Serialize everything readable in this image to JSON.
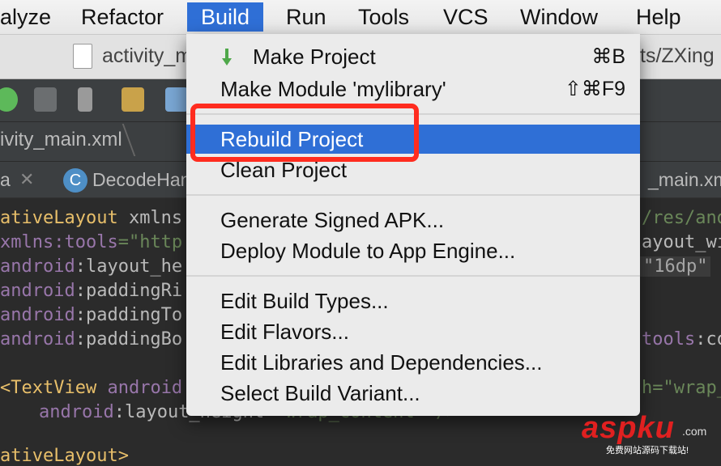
{
  "menubar": {
    "items": [
      "alyze",
      "Refactor",
      "Build",
      "Run",
      "Tools",
      "VCS",
      "Window",
      "Help"
    ],
    "active": "Build"
  },
  "titlebar": {
    "filename": "activity_m",
    "path_tail": "ts/ZXing"
  },
  "breadcrumb": {
    "file": "ivity_main.xml"
  },
  "tabs": [
    {
      "label": "a"
    },
    {
      "label": "DecodeHan",
      "icon": "C"
    },
    {
      "label": "_main.xm"
    }
  ],
  "editor": {
    "lines": [
      {
        "tag": "ativeLayout",
        "text": " xmlns"
      },
      {
        "ns": "xmlns:tools",
        "eq": "=\"http"
      },
      {
        "ns": "android",
        "attr": ":layout_he"
      },
      {
        "ns": "android",
        "attr": ":paddingRi"
      },
      {
        "ns": "android",
        "attr": ":paddingTo"
      },
      {
        "ns": "android",
        "attr": ":paddingBo"
      },
      {
        "tag": "<TextView",
        "ns": " android"
      },
      {
        "ns": "android",
        "attr": ":layout_height",
        "str": "=\"wrap_content\" />"
      },
      {
        "tag": "ativeLayout>"
      }
    ],
    "right": {
      "r1": "/res/and",
      "r2": "ayout_wid",
      "r3": "\"16dp\"",
      "r6_ns": "tools",
      "r6_attr": ":co",
      "r7": "h=\"wrap_"
    }
  },
  "build_menu": {
    "items": [
      {
        "label": "Make Project",
        "shortcut": "⌘B",
        "icon": "make-icon"
      },
      {
        "label": "Make Module 'mylibrary'",
        "shortcut": "⇧⌘F9"
      },
      {
        "label": "Rebuild Project",
        "selected": true
      },
      {
        "label": "Clean Project"
      },
      {
        "label": "Generate Signed APK..."
      },
      {
        "label": "Deploy Module to App Engine..."
      },
      {
        "label": "Edit Build Types..."
      },
      {
        "label": "Edit Flavors..."
      },
      {
        "label": "Edit Libraries and Dependencies..."
      },
      {
        "label": "Select Build Variant..."
      }
    ]
  },
  "colors": {
    "selection": "#2f6fd6",
    "highlight_box": "#ff2c1f",
    "editor_bg": "#2b2b2b"
  },
  "watermark": {
    "main": "aspku",
    "domain": ".com",
    "subtitle": "免费网站源码下载站!"
  }
}
